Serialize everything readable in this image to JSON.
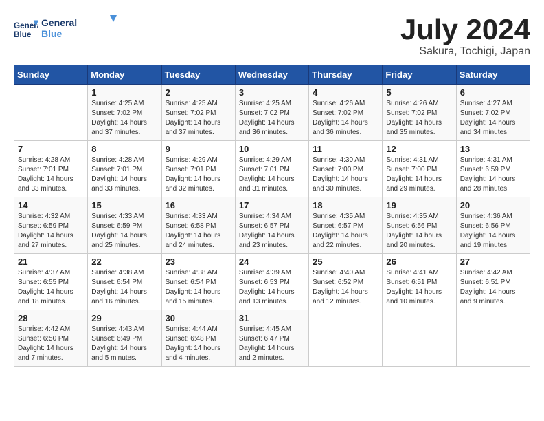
{
  "header": {
    "logo_line1": "General",
    "logo_line2": "Blue",
    "month": "July 2024",
    "location": "Sakura, Tochigi, Japan"
  },
  "weekdays": [
    "Sunday",
    "Monday",
    "Tuesday",
    "Wednesday",
    "Thursday",
    "Friday",
    "Saturday"
  ],
  "weeks": [
    [
      {
        "day": "",
        "info": ""
      },
      {
        "day": "1",
        "info": "Sunrise: 4:25 AM\nSunset: 7:02 PM\nDaylight: 14 hours\nand 37 minutes."
      },
      {
        "day": "2",
        "info": "Sunrise: 4:25 AM\nSunset: 7:02 PM\nDaylight: 14 hours\nand 37 minutes."
      },
      {
        "day": "3",
        "info": "Sunrise: 4:25 AM\nSunset: 7:02 PM\nDaylight: 14 hours\nand 36 minutes."
      },
      {
        "day": "4",
        "info": "Sunrise: 4:26 AM\nSunset: 7:02 PM\nDaylight: 14 hours\nand 36 minutes."
      },
      {
        "day": "5",
        "info": "Sunrise: 4:26 AM\nSunset: 7:02 PM\nDaylight: 14 hours\nand 35 minutes."
      },
      {
        "day": "6",
        "info": "Sunrise: 4:27 AM\nSunset: 7:02 PM\nDaylight: 14 hours\nand 34 minutes."
      }
    ],
    [
      {
        "day": "7",
        "info": "Sunrise: 4:28 AM\nSunset: 7:01 PM\nDaylight: 14 hours\nand 33 minutes."
      },
      {
        "day": "8",
        "info": "Sunrise: 4:28 AM\nSunset: 7:01 PM\nDaylight: 14 hours\nand 33 minutes."
      },
      {
        "day": "9",
        "info": "Sunrise: 4:29 AM\nSunset: 7:01 PM\nDaylight: 14 hours\nand 32 minutes."
      },
      {
        "day": "10",
        "info": "Sunrise: 4:29 AM\nSunset: 7:01 PM\nDaylight: 14 hours\nand 31 minutes."
      },
      {
        "day": "11",
        "info": "Sunrise: 4:30 AM\nSunset: 7:00 PM\nDaylight: 14 hours\nand 30 minutes."
      },
      {
        "day": "12",
        "info": "Sunrise: 4:31 AM\nSunset: 7:00 PM\nDaylight: 14 hours\nand 29 minutes."
      },
      {
        "day": "13",
        "info": "Sunrise: 4:31 AM\nSunset: 6:59 PM\nDaylight: 14 hours\nand 28 minutes."
      }
    ],
    [
      {
        "day": "14",
        "info": "Sunrise: 4:32 AM\nSunset: 6:59 PM\nDaylight: 14 hours\nand 27 minutes."
      },
      {
        "day": "15",
        "info": "Sunrise: 4:33 AM\nSunset: 6:59 PM\nDaylight: 14 hours\nand 25 minutes."
      },
      {
        "day": "16",
        "info": "Sunrise: 4:33 AM\nSunset: 6:58 PM\nDaylight: 14 hours\nand 24 minutes."
      },
      {
        "day": "17",
        "info": "Sunrise: 4:34 AM\nSunset: 6:57 PM\nDaylight: 14 hours\nand 23 minutes."
      },
      {
        "day": "18",
        "info": "Sunrise: 4:35 AM\nSunset: 6:57 PM\nDaylight: 14 hours\nand 22 minutes."
      },
      {
        "day": "19",
        "info": "Sunrise: 4:35 AM\nSunset: 6:56 PM\nDaylight: 14 hours\nand 20 minutes."
      },
      {
        "day": "20",
        "info": "Sunrise: 4:36 AM\nSunset: 6:56 PM\nDaylight: 14 hours\nand 19 minutes."
      }
    ],
    [
      {
        "day": "21",
        "info": "Sunrise: 4:37 AM\nSunset: 6:55 PM\nDaylight: 14 hours\nand 18 minutes."
      },
      {
        "day": "22",
        "info": "Sunrise: 4:38 AM\nSunset: 6:54 PM\nDaylight: 14 hours\nand 16 minutes."
      },
      {
        "day": "23",
        "info": "Sunrise: 4:38 AM\nSunset: 6:54 PM\nDaylight: 14 hours\nand 15 minutes."
      },
      {
        "day": "24",
        "info": "Sunrise: 4:39 AM\nSunset: 6:53 PM\nDaylight: 14 hours\nand 13 minutes."
      },
      {
        "day": "25",
        "info": "Sunrise: 4:40 AM\nSunset: 6:52 PM\nDaylight: 14 hours\nand 12 minutes."
      },
      {
        "day": "26",
        "info": "Sunrise: 4:41 AM\nSunset: 6:51 PM\nDaylight: 14 hours\nand 10 minutes."
      },
      {
        "day": "27",
        "info": "Sunrise: 4:42 AM\nSunset: 6:51 PM\nDaylight: 14 hours\nand 9 minutes."
      }
    ],
    [
      {
        "day": "28",
        "info": "Sunrise: 4:42 AM\nSunset: 6:50 PM\nDaylight: 14 hours\nand 7 minutes."
      },
      {
        "day": "29",
        "info": "Sunrise: 4:43 AM\nSunset: 6:49 PM\nDaylight: 14 hours\nand 5 minutes."
      },
      {
        "day": "30",
        "info": "Sunrise: 4:44 AM\nSunset: 6:48 PM\nDaylight: 14 hours\nand 4 minutes."
      },
      {
        "day": "31",
        "info": "Sunrise: 4:45 AM\nSunset: 6:47 PM\nDaylight: 14 hours\nand 2 minutes."
      },
      {
        "day": "",
        "info": ""
      },
      {
        "day": "",
        "info": ""
      },
      {
        "day": "",
        "info": ""
      }
    ]
  ]
}
